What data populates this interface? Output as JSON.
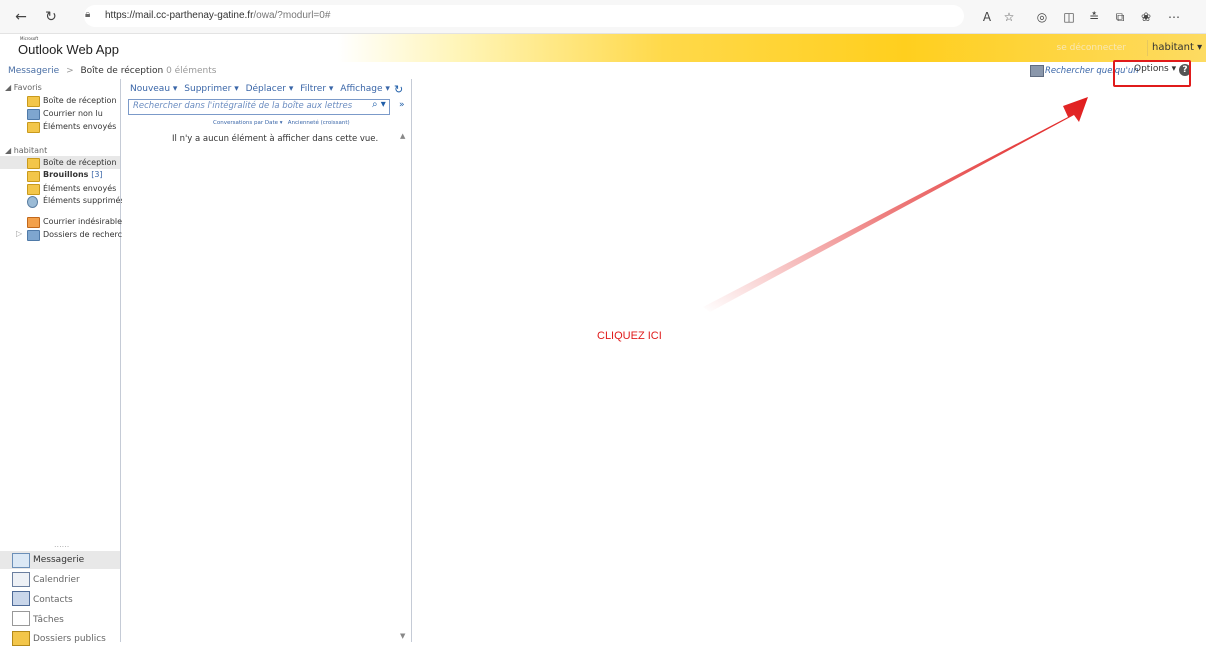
{
  "browser": {
    "url_host": "https://mail.cc-parthenay-gatine.fr",
    "url_path": "/owa/?modurl=0#",
    "icons": [
      "back-icon",
      "refresh-icon",
      "lock-icon",
      "read-aloud-icon",
      "favorite-star-icon",
      "extensions-icon",
      "split-screen-icon",
      "favorites-icon",
      "collections-icon",
      "extension-icon",
      "more-icon"
    ]
  },
  "header": {
    "ms_label": "Microsoft",
    "app_title": "Outlook Web App",
    "signout": "se déconnecter",
    "user": "habitant ▾"
  },
  "breadcrumb": {
    "root": "Messagerie",
    "sep": ">",
    "folder": "Boîte de réception",
    "count": "0 éléments"
  },
  "topright": {
    "find_people": "Rechercher quelqu'un",
    "options": "Options ▾",
    "help": "?"
  },
  "nav": {
    "favorites_header": "◢ Favoris",
    "favorites": [
      "Boîte de réception",
      "Courrier non lu",
      "Éléments envoyés"
    ],
    "mailbox_header": "◢ habitant",
    "folders": [
      {
        "label": "Boîte de réception"
      },
      {
        "label": "Brouillons",
        "count": "[3]"
      },
      {
        "label": "Éléments envoyés"
      },
      {
        "label": "Éléments supprimés"
      },
      {
        "label": "Courrier indésirable"
      },
      {
        "label": "Dossiers de recherche"
      }
    ],
    "dots": "......",
    "bottom": [
      "Messagerie",
      "Calendrier",
      "Contacts",
      "Tâches",
      "Dossiers publics"
    ]
  },
  "toolbar": {
    "new": "Nouveau ▾",
    "delete": "Supprimer ▾",
    "move": "Déplacer ▾",
    "filter": "Filtrer ▾",
    "view": "Affichage ▾"
  },
  "search": {
    "placeholder": "Rechercher dans l'intégralité de la boîte aux lettres"
  },
  "sort": {
    "by": "Conversations par Date ▾",
    "order": "Ancienneté (croissant)"
  },
  "list": {
    "empty": "Il n'y a aucun élément à afficher dans cette vue."
  },
  "annotation": {
    "label": "CLIQUEZ ICI",
    "color": "#e01b1b"
  }
}
